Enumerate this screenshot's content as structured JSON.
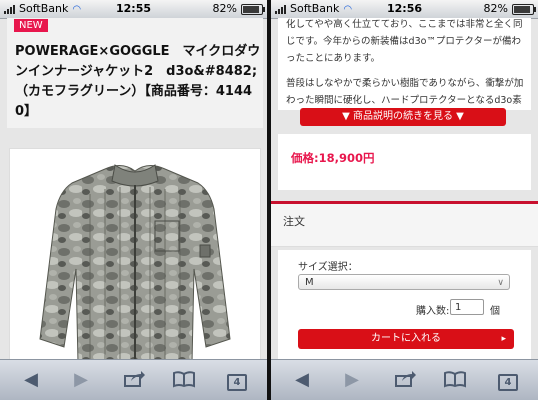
{
  "left": {
    "status": {
      "carrier": "SoftBank",
      "time": "12:55",
      "battery": "82%"
    },
    "badge": "NEW",
    "product_title": "POWERAGE×GOGGLE　マイクロダウンインナージャケット2　d3o&#8482;（カモフラグリーン）【商品番号：41440】",
    "toolbar": {
      "tabs_count": "4"
    }
  },
  "right": {
    "status": {
      "carrier": "SoftBank",
      "time": "12:56",
      "battery": "82%"
    },
    "description_lines": [
      "化してやや高く仕立てており、ここまでは非常と全く同",
      "じです。今年からの新装備はd3o™プロテクターが備わ",
      "ったことにあります。",
      "",
      "普段はしなやかで柔らかい樹脂でありながら、衝撃が加",
      "わった瞬間に硬化し、ハードプロテクターとなるd3o素"
    ],
    "more_button": "▼ 商品説明の続きを見る ▼",
    "price": "価格:18,900円",
    "order_title": "注文",
    "size_label": "サイズ選択：",
    "size_value": "M",
    "qty_label": "購入数:",
    "qty_value": "1",
    "qty_unit": "個",
    "cart_button": "カートに入れる",
    "toolbar": {
      "tabs_count": "4"
    }
  },
  "icons": {
    "back": "back-arrow-icon",
    "forward": "forward-arrow-icon",
    "share": "share-icon",
    "bookmarks": "bookmarks-icon",
    "tabs": "tabs-icon"
  },
  "colors": {
    "accent_red": "#d90f17",
    "price_pink": "#e8174d",
    "toolbar_blue_gray": "#aeb6c2"
  }
}
